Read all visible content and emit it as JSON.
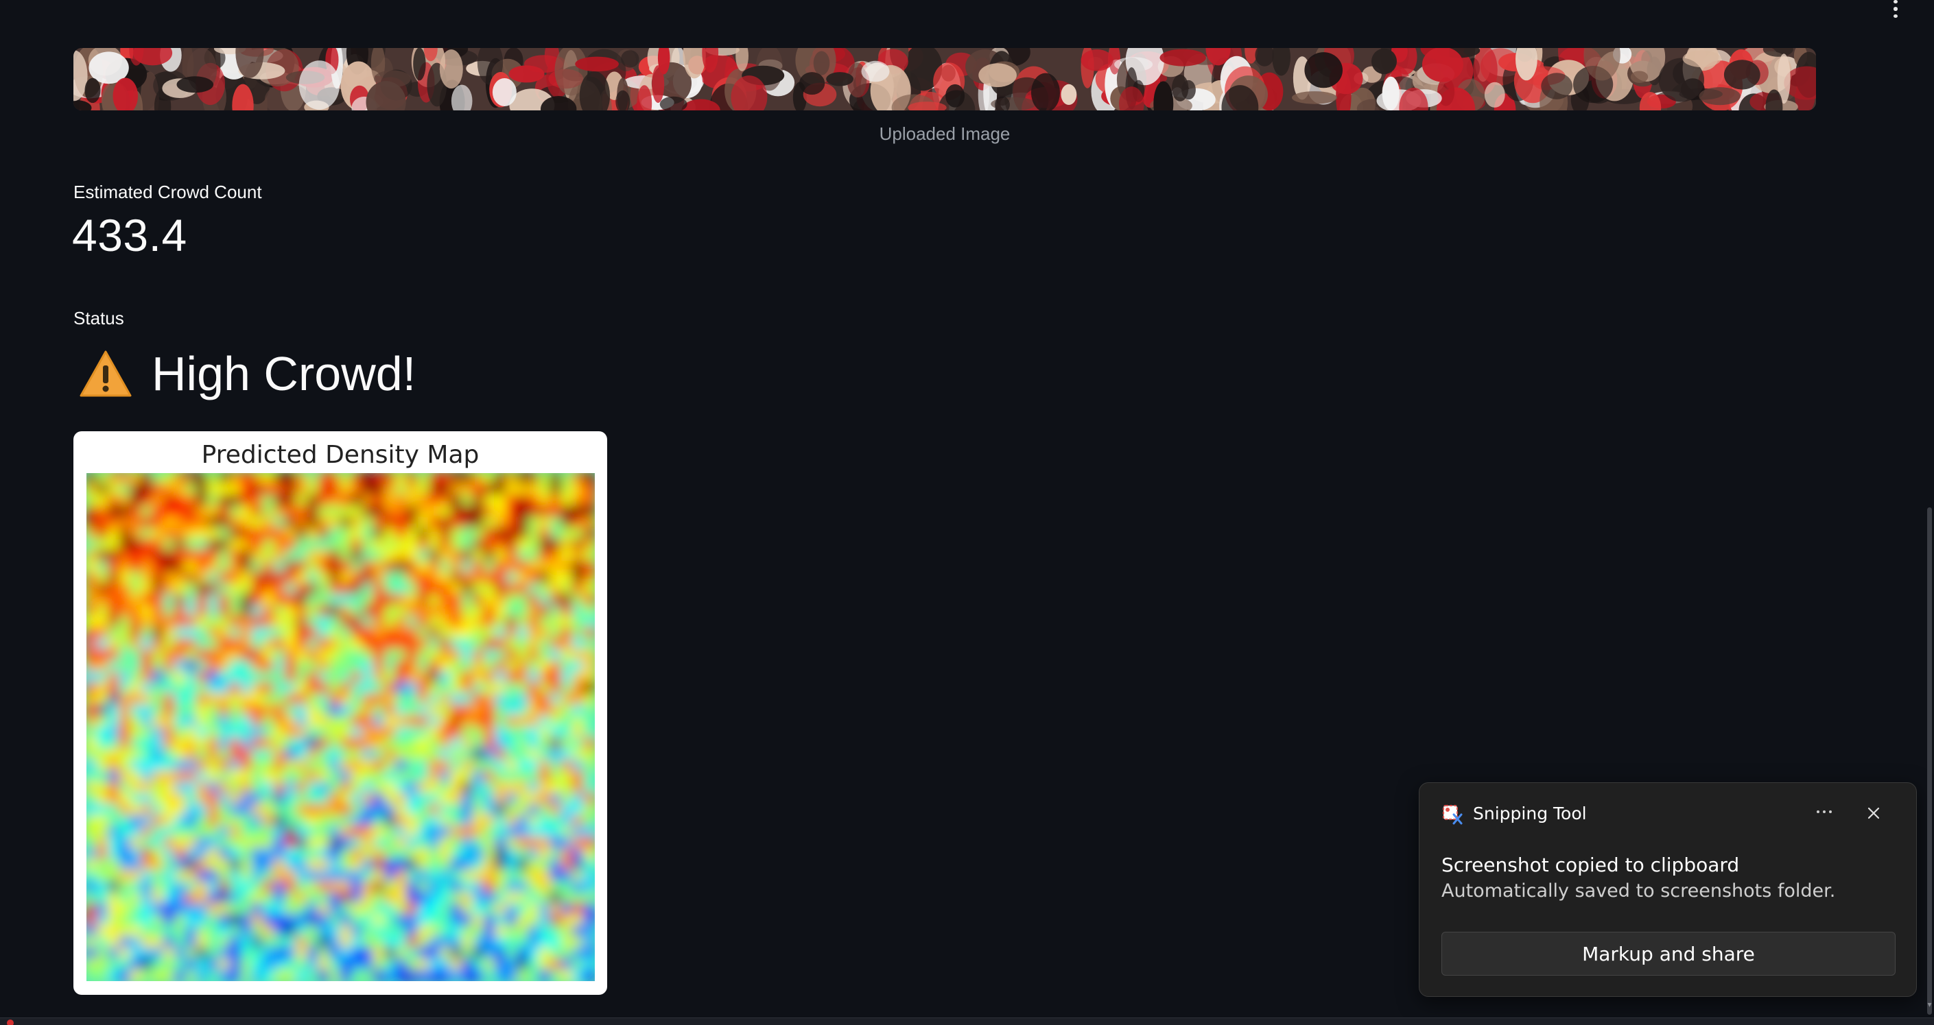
{
  "image": {
    "caption": "Uploaded Image"
  },
  "metrics": {
    "count_label": "Estimated Crowd Count",
    "count_value": "433.4",
    "status_label": "Status",
    "status_value": "High Crowd!",
    "status_icon": "warning-icon"
  },
  "figure": {
    "title": "Predicted Density Map",
    "colormap": "jet"
  },
  "toast": {
    "app_name": "Snipping Tool",
    "title": "Screenshot copied to clipboard",
    "body": "Automatically saved to screenshots folder.",
    "button_label": "Markup and share",
    "more_icon": "more-icon",
    "close_icon": "close-icon"
  },
  "colors": {
    "background": "#0e1117",
    "toast_background": "#202020",
    "warning": "#f2a33a"
  }
}
